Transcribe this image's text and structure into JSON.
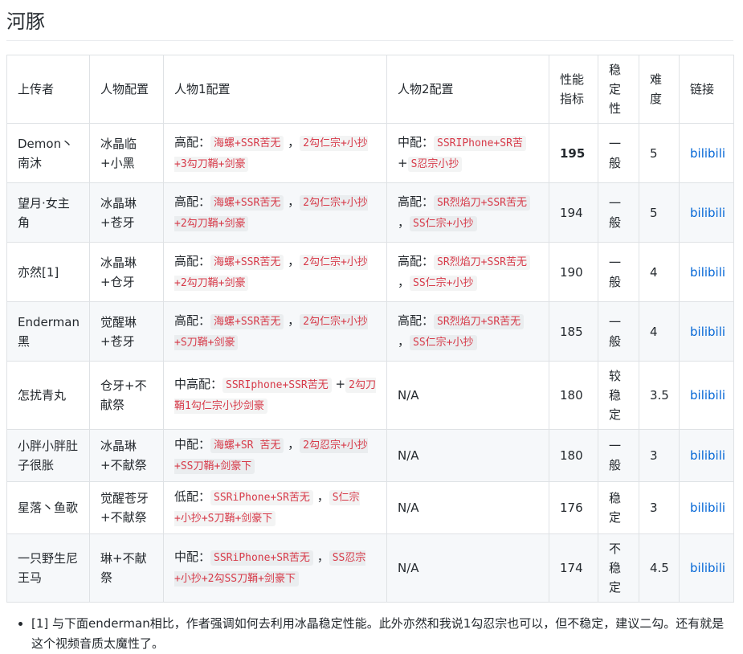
{
  "heading": "河豚",
  "columns": [
    "上传者",
    "人物配置",
    "人物1配置",
    "人物2配置",
    "性能指标",
    "稳定性",
    "难度",
    "链接"
  ],
  "rows": [
    {
      "uploader": "Demon丶南沐",
      "chars": "冰晶临+小黑",
      "c1": [
        {
          "t": "text",
          "v": "高配："
        },
        {
          "t": "code",
          "v": "海螺+SSR苦无"
        },
        {
          "t": "text",
          "v": "，"
        },
        {
          "t": "code",
          "v": "2勾仁宗+小抄+3勾刀鞘+剑豪"
        }
      ],
      "c2": [
        {
          "t": "text",
          "v": "中配："
        },
        {
          "t": "code",
          "v": "SSRIPhone+SR苦"
        },
        {
          "t": "text",
          "v": "+"
        },
        {
          "t": "code",
          "v": "S忍宗小抄"
        }
      ],
      "perf": "195",
      "perf_bold": true,
      "stability": "一般",
      "difficulty": "5",
      "link": "bilibili"
    },
    {
      "uploader": "望月·女主角",
      "chars": "冰晶琳+苍牙",
      "c1": [
        {
          "t": "text",
          "v": "高配："
        },
        {
          "t": "code",
          "v": "海螺+SSR苦无"
        },
        {
          "t": "text",
          "v": "，"
        },
        {
          "t": "code",
          "v": "2勾仁宗+小抄+2勾刀鞘+剑豪"
        }
      ],
      "c2": [
        {
          "t": "text",
          "v": "高配："
        },
        {
          "t": "code",
          "v": "SR烈焰刀+SSR苦无"
        },
        {
          "t": "text",
          "v": "，"
        },
        {
          "t": "code",
          "v": "SS仁宗+小抄"
        }
      ],
      "perf": "194",
      "stability": "一般",
      "difficulty": "5",
      "link": "bilibili"
    },
    {
      "uploader": "亦然[1]",
      "chars": "冰晶琳+仓牙",
      "c1": [
        {
          "t": "text",
          "v": "高配："
        },
        {
          "t": "code",
          "v": "海螺+SSR苦无"
        },
        {
          "t": "text",
          "v": "，"
        },
        {
          "t": "code",
          "v": "2勾仁宗+小抄+2勾刀鞘+剑豪"
        }
      ],
      "c2": [
        {
          "t": "text",
          "v": "高配："
        },
        {
          "t": "code",
          "v": "SR烈焰刀+SSR苦无"
        },
        {
          "t": "text",
          "v": "，"
        },
        {
          "t": "code",
          "v": "SS仁宗+小抄"
        }
      ],
      "perf": "190",
      "stability": "一般",
      "difficulty": "4",
      "link": "bilibili"
    },
    {
      "uploader": "Enderman黑",
      "chars": "觉醒琳+苍牙",
      "c1": [
        {
          "t": "text",
          "v": "高配："
        },
        {
          "t": "code",
          "v": "海螺+SSR苦无"
        },
        {
          "t": "text",
          "v": "，"
        },
        {
          "t": "code",
          "v": "2勾仁宗+小抄+S刀鞘+剑豪"
        }
      ],
      "c2": [
        {
          "t": "text",
          "v": "高配："
        },
        {
          "t": "code",
          "v": "SR烈焰刀+SR苦无"
        },
        {
          "t": "text",
          "v": "，"
        },
        {
          "t": "code",
          "v": "SS仁宗+小抄"
        }
      ],
      "perf": "185",
      "stability": "一般",
      "difficulty": "4",
      "link": "bilibili"
    },
    {
      "uploader": "怎扰青丸",
      "chars": "仓牙+不献祭",
      "c1": [
        {
          "t": "text",
          "v": "中高配："
        },
        {
          "t": "code",
          "v": "SSRIphone+SSR苦无"
        },
        {
          "t": "text",
          "v": "+"
        },
        {
          "t": "code",
          "v": "2勾刀鞘1勾仁宗小抄剑豪"
        }
      ],
      "c2": [
        {
          "t": "text",
          "v": "N/A"
        }
      ],
      "perf": "180",
      "stability": "较稳定",
      "difficulty": "3.5",
      "link": "bilibili"
    },
    {
      "uploader": "小胖小胖肚子很胀",
      "chars": "冰晶琳+不献祭",
      "c1": [
        {
          "t": "text",
          "v": "中配："
        },
        {
          "t": "code",
          "v": "海螺+SR 苦无"
        },
        {
          "t": "text",
          "v": "，"
        },
        {
          "t": "code",
          "v": "2勾忍宗+小抄+SS刀鞘+剑豪下"
        }
      ],
      "c2": [
        {
          "t": "text",
          "v": "N/A"
        }
      ],
      "perf": "180",
      "stability": "一般",
      "difficulty": "3",
      "link": "bilibili"
    },
    {
      "uploader": "星落丶鱼歌",
      "chars": "觉醒苍牙+不献祭",
      "c1": [
        {
          "t": "text",
          "v": "低配："
        },
        {
          "t": "code",
          "v": "SSRiPhone+SR苦无"
        },
        {
          "t": "text",
          "v": "，"
        },
        {
          "t": "code",
          "v": "S仁宗+小抄+S刀鞘+剑豪下"
        }
      ],
      "c2": [
        {
          "t": "text",
          "v": "N/A"
        }
      ],
      "perf": "176",
      "stability": "稳定",
      "difficulty": "3",
      "link": "bilibili"
    },
    {
      "uploader": "一只野生尼王马",
      "chars": "琳+不献祭",
      "c1": [
        {
          "t": "text",
          "v": "中配："
        },
        {
          "t": "code",
          "v": "SSRiPhone+SR苦无"
        },
        {
          "t": "text",
          "v": "，"
        },
        {
          "t": "code",
          "v": "SS忍宗+小抄+2勾SS刀鞘+剑豪下"
        }
      ],
      "c2": [
        {
          "t": "text",
          "v": "N/A"
        }
      ],
      "perf": "174",
      "stability": "不稳定",
      "difficulty": "4.5",
      "link": "bilibili"
    }
  ],
  "footnote": "[1] 与下面enderman相比，作者强调如何去利用冰晶稳定性能。此外亦然和我说1勾忍宗也可以，但不稳定，建议二勾。还有就是这个视频音质太魔性了。"
}
